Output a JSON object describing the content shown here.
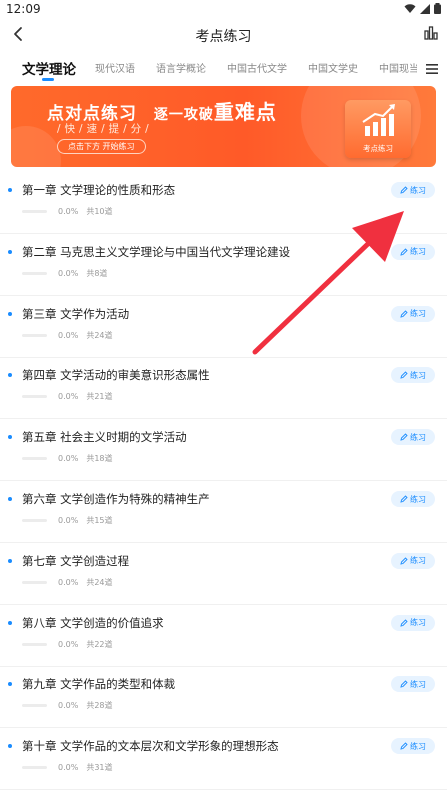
{
  "status_bar": {
    "time": "12:09"
  },
  "nav": {
    "title": "考点练习"
  },
  "tabs": [
    {
      "label": "文学理论",
      "active": true
    },
    {
      "label": "现代汉语",
      "active": false
    },
    {
      "label": "语言学概论",
      "active": false
    },
    {
      "label": "中国古代文学",
      "active": false
    },
    {
      "label": "中国文学史",
      "active": false
    },
    {
      "label": "中国现当",
      "active": false
    }
  ],
  "banner": {
    "title_part1": "点对点练习",
    "title_part2": "逐一攻破",
    "title_big": "重难点",
    "subtitle": "/快/速/提/分/",
    "button_label": "点击下方 开始练习",
    "card_label": "考点练习"
  },
  "chapters": [
    {
      "title": "第一章 文学理论的性质和形态",
      "progress": "0.0%",
      "count": "共10道"
    },
    {
      "title": "第二章 马克思主义文学理论与中国当代文学理论建设",
      "progress": "0.0%",
      "count": "共8道"
    },
    {
      "title": "第三章 文学作为活动",
      "progress": "0.0%",
      "count": "共24道"
    },
    {
      "title": "第四章 文学活动的审美意识形态属性",
      "progress": "0.0%",
      "count": "共21道"
    },
    {
      "title": "第五章 社会主义时期的文学活动",
      "progress": "0.0%",
      "count": "共18道"
    },
    {
      "title": "第六章 文学创造作为特殊的精神生产",
      "progress": "0.0%",
      "count": "共15道"
    },
    {
      "title": "第七章 文学创造过程",
      "progress": "0.0%",
      "count": "共24道"
    },
    {
      "title": "第八章 文学创造的价值追求",
      "progress": "0.0%",
      "count": "共22道"
    },
    {
      "title": "第九章 文学作品的类型和体裁",
      "progress": "0.0%",
      "count": "共28道"
    },
    {
      "title": "第十章 文学作品的文本层次和文学形象的理想形态",
      "progress": "0.0%",
      "count": "共31道"
    }
  ],
  "practice_label": "练习",
  "colors": {
    "accent": "#1a8cff",
    "banner": "#ff5a28",
    "arrow": "#f0303f"
  },
  "icons": {
    "back": "chevron-left-icon",
    "stats": "bar-chart-icon",
    "menu": "menu-icon",
    "practice": "pencil-icon"
  }
}
